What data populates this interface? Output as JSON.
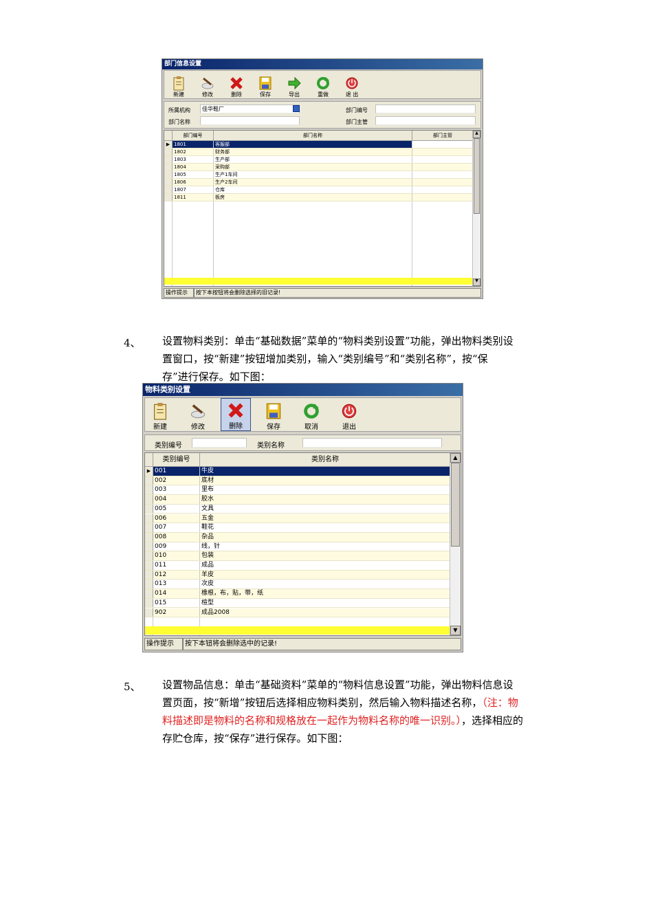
{
  "dept_window": {
    "title": "部门信息设置",
    "toolbar": [
      "新建",
      "修改",
      "删除",
      "保存",
      "导出",
      "重做",
      "退 出"
    ],
    "form": {
      "org_label": "所属机构",
      "org_value": "佳华鞋厂",
      "dept_no_label": "部门编号",
      "dept_name_label": "部门名称",
      "dept_manager_label": "部门主管"
    },
    "grid": {
      "headers": [
        "部门编号",
        "部门名称",
        "部门主管"
      ],
      "rows": [
        [
          "1801",
          "客服部",
          ""
        ],
        [
          "1802",
          "财务部",
          ""
        ],
        [
          "1803",
          "生产部",
          ""
        ],
        [
          "1804",
          "采购部",
          ""
        ],
        [
          "1805",
          "生产1车间",
          ""
        ],
        [
          "1806",
          "生产2车间",
          ""
        ],
        [
          "1807",
          "仓库",
          ""
        ],
        [
          "1811",
          "板房",
          ""
        ]
      ]
    },
    "status_label": "操作提示",
    "status_text": "按下本按钮将会删除选择的旧记录!"
  },
  "para4": {
    "num": "4、",
    "lines": [
      "设置物料类别：单击“基础数据”菜单的“物料类别设置”功能，弹出物料类别设",
      "置窗口，按“新建”按钮增加类别，输入“类别编号”和“类别名称”，按“保",
      "存”进行保存。如下图："
    ]
  },
  "cat_window": {
    "title": "物料类别设置",
    "toolbar": [
      "新建",
      "修改",
      "删除",
      "保存",
      "取消",
      "退出"
    ],
    "form": {
      "cat_no_label": "类别编号",
      "cat_name_label": "类别名称"
    },
    "grid": {
      "headers": [
        "类别编号",
        "类别名称"
      ],
      "rows": [
        [
          "001",
          "牛皮"
        ],
        [
          "002",
          "底材"
        ],
        [
          "003",
          "里布"
        ],
        [
          "004",
          "胶水"
        ],
        [
          "005",
          "文具"
        ],
        [
          "006",
          "五金"
        ],
        [
          "007",
          "鞋花"
        ],
        [
          "008",
          "杂品"
        ],
        [
          "009",
          "线，针"
        ],
        [
          "010",
          "包装"
        ],
        [
          "011",
          "成品"
        ],
        [
          "012",
          "羊皮"
        ],
        [
          "013",
          "次皮"
        ],
        [
          "014",
          "橡根，布，贴，带，纸"
        ],
        [
          "015",
          "楦型"
        ],
        [
          "902",
          "成品2008"
        ]
      ]
    },
    "status_label": "操作提示",
    "status_text": "按下本钮将会删除选中的记录!"
  },
  "para5": {
    "num": "5、",
    "line1": "设置物品信息：单击“基础资料”菜单的“物料信息设置”功能，弹出物料信息设",
    "line2_a": "置页面，按“新增”按钮后选择相应物料类别，然后输入物料描述名称，",
    "line2_red": "（注：物",
    "line3_red": "料描述即是物料的名称和规格放在一起作为物料名称的唯一识别。）",
    "line3_b": "，选择相应的",
    "line4": "存贮仓库，按“保存”进行保存。如下图："
  },
  "colors": {
    "title_bar": "#0a246a",
    "selection": "#0a246a",
    "row_alt": "#fffbe0",
    "new_row": "#ffff33",
    "note_red": "#e02020"
  }
}
